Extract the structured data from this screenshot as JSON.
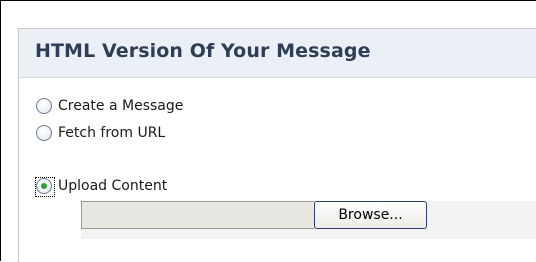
{
  "panel": {
    "title": "HTML Version Of Your Message"
  },
  "options": [
    {
      "label": "Create a Message",
      "checked": false
    },
    {
      "label": "Fetch from URL",
      "checked": false
    },
    {
      "label": "Upload Content",
      "checked": true
    }
  ],
  "upload": {
    "file_value": "",
    "browse_label": "Browse..."
  },
  "colors": {
    "header_bg": "#eaf0f6",
    "title_text": "#2f3d55",
    "selected_dot": "#2ca02c"
  }
}
